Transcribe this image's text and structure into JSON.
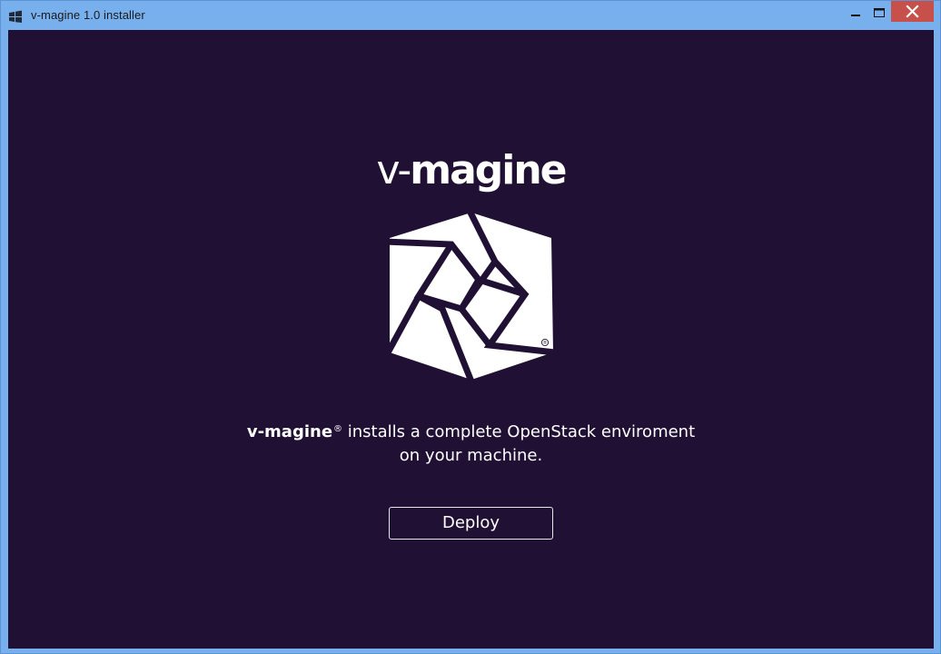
{
  "window": {
    "title": "v-magine 1.0 installer",
    "icon": "windows-logo-icon",
    "controls": {
      "minimize": "minimize-icon",
      "maximize": "maximize-icon",
      "close": "close-icon"
    }
  },
  "brand": {
    "name_prefix": "v-",
    "name_main": "magine",
    "logo_icon": "v-magine-hexagon-logo",
    "registered_mark": "®"
  },
  "tagline": {
    "brand": "v-magine",
    "reg": "®",
    "line1_rest": " installs a complete OpenStack enviroment",
    "line2": "on your machine."
  },
  "actions": {
    "deploy_label": "Deploy"
  },
  "colors": {
    "background": "#201033",
    "titlebar": "#78b0ee",
    "close_button": "#c7514a",
    "text": "#ffffff"
  }
}
